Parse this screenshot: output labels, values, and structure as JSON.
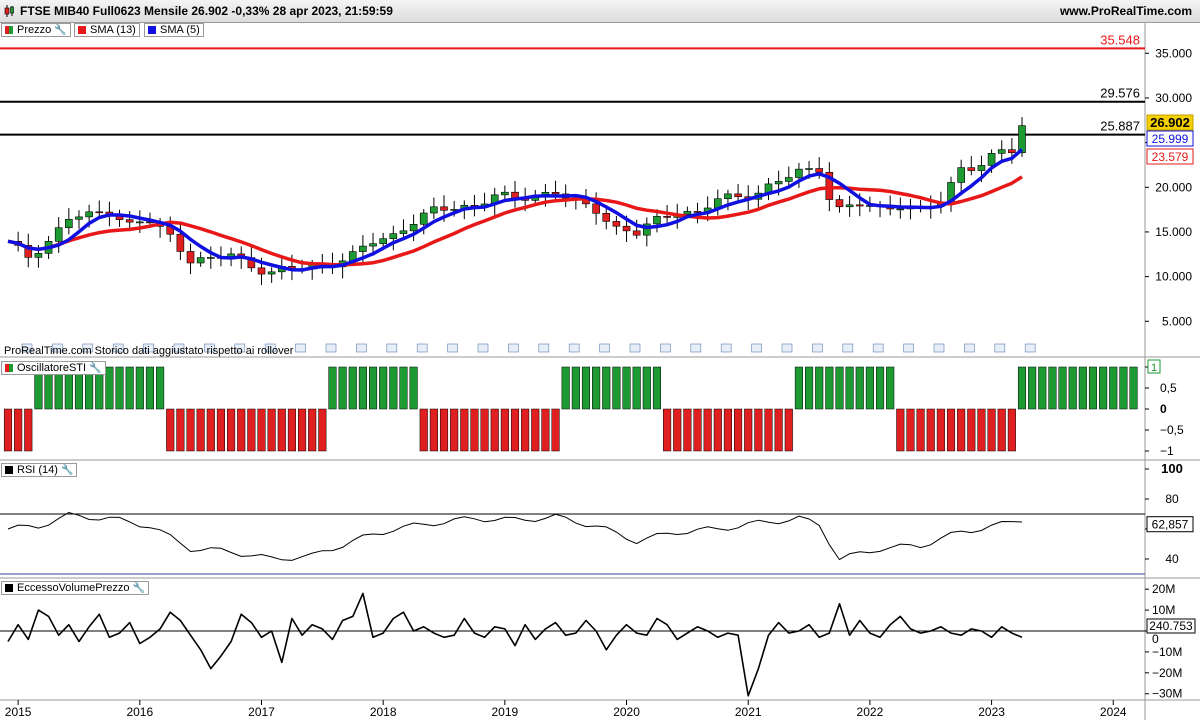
{
  "header": {
    "title": "FTSE MIB40 Full0623 Mensile 26.902 -0,33% 28 apr 2023, 21:59:59",
    "brand": "www.ProRealTime.com"
  },
  "legend": {
    "price": "Prezzo",
    "sma13": "SMA (13)",
    "sma5": "SMA (5)",
    "sti": "OscillatoreSTI",
    "rsi": "RSI (14)",
    "evp": "EccessoVolumePrezzo"
  },
  "note": "ProRealTime.com  Storico dati aggiustato rispetto ai rollover",
  "colors": {
    "up": "#1e9a33",
    "down": "#e02020",
    "sma13": "#e81818",
    "sma5": "#1010e0",
    "level": "#e81818"
  },
  "chart_data": [
    {
      "type": "candlestick",
      "x_labels": [
        "2015",
        "2016",
        "2017",
        "2018",
        "2019",
        "2020",
        "2021",
        "2022",
        "2023",
        "2024"
      ],
      "y_ticks": [
        5000,
        10000,
        15000,
        20000,
        25000,
        30000,
        35000
      ],
      "y_tick_labels": [
        "5.000",
        "10.000",
        "15.000",
        "20.000",
        "25.000",
        "30.000",
        "35.000"
      ],
      "ylim": [
        1000,
        38500
      ],
      "start": "2014-12",
      "end": "2023-04",
      "hlines": [
        {
          "value": 35548,
          "label": "35.548",
          "color": "#e81818"
        },
        {
          "value": 29576,
          "label": "29.576",
          "color": "#000000"
        },
        {
          "value": 25887,
          "label": "25.887",
          "color": "#000000"
        }
      ],
      "last_values": [
        {
          "value": 26902,
          "label": "26.902",
          "kind": "price"
        },
        {
          "value": 25999,
          "label": "25.999",
          "kind": "sma5"
        },
        {
          "value": 23579,
          "label": "23.579",
          "kind": "sma13"
        }
      ],
      "anchors": [
        [
          0,
          13700
        ],
        [
          2,
          12300
        ],
        [
          4,
          14000
        ],
        [
          6,
          16500
        ],
        [
          8,
          16800
        ],
        [
          10,
          17500
        ],
        [
          12,
          15800
        ],
        [
          14,
          16200
        ],
        [
          16,
          14500
        ],
        [
          18,
          12000
        ],
        [
          20,
          11800
        ],
        [
          22,
          12500
        ],
        [
          24,
          11200
        ],
        [
          26,
          10500
        ],
        [
          28,
          10800
        ],
        [
          30,
          11200
        ],
        [
          32,
          11600
        ],
        [
          34,
          12300
        ],
        [
          36,
          13900
        ],
        [
          38,
          14700
        ],
        [
          40,
          16200
        ],
        [
          42,
          17300
        ],
        [
          44,
          17800
        ],
        [
          46,
          18000
        ],
        [
          48,
          19000
        ],
        [
          50,
          18700
        ],
        [
          52,
          19200
        ],
        [
          54,
          19500
        ],
        [
          56,
          18200
        ],
        [
          58,
          17500
        ],
        [
          60,
          15500
        ],
        [
          62,
          14800
        ],
        [
          64,
          16300
        ],
        [
          66,
          17500
        ],
        [
          68,
          17000
        ],
        [
          70,
          18600
        ],
        [
          72,
          19000
        ],
        [
          74,
          19500
        ],
        [
          76,
          20600
        ],
        [
          78,
          21700
        ],
        [
          80,
          22200
        ],
        [
          81,
          19000
        ],
        [
          82,
          17500
        ],
        [
          84,
          18000
        ],
        [
          86,
          17700
        ],
        [
          88,
          18100
        ],
        [
          90,
          17300
        ],
        [
          92,
          18400
        ],
        [
          94,
          22300
        ],
        [
          96,
          22500
        ],
        [
          98,
          24000
        ],
        [
          100,
          24200
        ],
        [
          102,
          25000
        ],
        [
          104,
          26000
        ],
        [
          106,
          26500
        ],
        [
          108,
          26200
        ],
        [
          110,
          23000
        ],
        [
          112,
          24500
        ],
        [
          114,
          22300
        ],
        [
          116,
          21600
        ],
        [
          118,
          21200
        ],
        [
          120,
          21000
        ],
        [
          122,
          22000
        ],
        [
          124,
          25500
        ],
        [
          126,
          27500
        ],
        [
          128,
          27700
        ],
        [
          100,
          24200
        ]
      ],
      "series": [
        {
          "name": "SMA (13)",
          "color": "#e81818"
        },
        {
          "name": "SMA (5)",
          "color": "#1010e0"
        }
      ]
    },
    {
      "type": "bar",
      "title": "OscillatoreSTI",
      "y_tick_labels": [
        "1",
        "0,5",
        "0",
        "−0,5",
        "−1"
      ],
      "last_label": "1",
      "ylim": [
        -1.2,
        1.2
      ],
      "runs": [
        [
          3,
          -1
        ],
        [
          13,
          1
        ],
        [
          16,
          -1
        ],
        [
          9,
          1
        ],
        [
          14,
          -1
        ],
        [
          10,
          1
        ],
        [
          13,
          -1
        ],
        [
          10,
          1
        ],
        [
          12,
          -1
        ],
        [
          8,
          1
        ],
        [
          4,
          1
        ]
      ]
    },
    {
      "type": "line",
      "title": "RSI (14)",
      "y_tick_labels": [
        "100",
        "80",
        "60",
        "40"
      ],
      "ylim": [
        30,
        100
      ],
      "levels": [
        70,
        30
      ],
      "last_label": "62,857",
      "anchors": [
        [
          0,
          60
        ],
        [
          3,
          62
        ],
        [
          6,
          69
        ],
        [
          10,
          67
        ],
        [
          14,
          62
        ],
        [
          18,
          47
        ],
        [
          22,
          45
        ],
        [
          26,
          40
        ],
        [
          30,
          42
        ],
        [
          34,
          52
        ],
        [
          38,
          60
        ],
        [
          42,
          64
        ],
        [
          46,
          67
        ],
        [
          50,
          66
        ],
        [
          54,
          68
        ],
        [
          58,
          62
        ],
        [
          62,
          52
        ],
        [
          66,
          58
        ],
        [
          70,
          60
        ],
        [
          74,
          64
        ],
        [
          78,
          67
        ],
        [
          80,
          63
        ],
        [
          82,
          40
        ],
        [
          86,
          47
        ],
        [
          90,
          49
        ],
        [
          94,
          58
        ],
        [
          98,
          63
        ],
        [
          102,
          70
        ],
        [
          104,
          74
        ],
        [
          108,
          68
        ],
        [
          112,
          60
        ],
        [
          114,
          54
        ],
        [
          118,
          48
        ],
        [
          122,
          54
        ],
        [
          124,
          60
        ],
        [
          128,
          63
        ]
      ]
    },
    {
      "type": "line",
      "title": "EccessoVolumePrezzo",
      "y_tick_labels": [
        "20M",
        "10M",
        "0",
        "−10M",
        "−20M",
        "−30M"
      ],
      "ylim": [
        -33000000,
        22000000
      ],
      "last_label": "240.753",
      "values": [
        -5,
        3,
        -4,
        10,
        7,
        -2,
        3,
        -5,
        2,
        8,
        -3,
        -1,
        4,
        -6,
        -3,
        1,
        9,
        5,
        -2,
        -9,
        -18,
        -12,
        -5,
        8,
        4,
        -3,
        0,
        -15,
        6,
        -2,
        3,
        1,
        -4,
        5,
        7,
        18,
        -3,
        -1,
        6,
        9,
        0,
        2,
        -1,
        -3,
        -2,
        6,
        -1,
        -3,
        2,
        1,
        -7,
        3,
        -4,
        1,
        4,
        -2,
        -1,
        5,
        0,
        -9,
        -2,
        3,
        -1,
        -2,
        6,
        3,
        -4,
        -1,
        2,
        0,
        -3,
        -1,
        -2,
        -31,
        -18,
        -2,
        4,
        -1,
        0,
        3,
        -3,
        -1,
        13,
        -2,
        5,
        -1,
        -3,
        3,
        7,
        1,
        -1,
        0,
        2,
        -1,
        -2,
        1,
        0,
        -3,
        2,
        -1,
        -3,
        3,
        1,
        -1,
        0,
        -7,
        4,
        -2,
        3,
        0,
        -1,
        2,
        5,
        1,
        -2,
        0,
        -3,
        -1,
        5,
        3,
        -2,
        -1,
        2,
        -3,
        0,
        1,
        0
      ]
    }
  ]
}
